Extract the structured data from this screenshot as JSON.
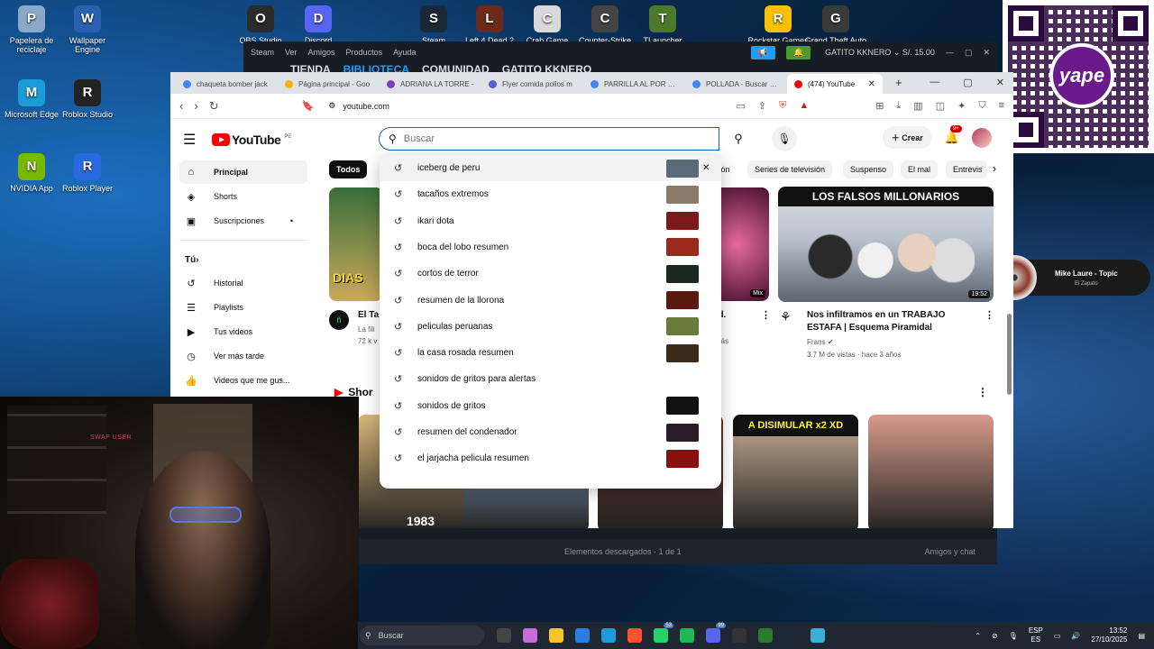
{
  "desktop": {
    "icons": [
      {
        "label": "Papelera de reciclaje",
        "icon": "recycle-bin-icon",
        "color": "#8aa9c9"
      },
      {
        "label": "Wallpaper Engine",
        "icon": "wallpaper-engine-icon",
        "color": "#2b5fb0"
      },
      {
        "label": "Microsoft Edge",
        "icon": "edge-icon",
        "color": "#1d9bd8"
      },
      {
        "label": "Roblox Studio",
        "icon": "roblox-studio-icon",
        "color": "#222222"
      },
      {
        "label": "NVIDIA App",
        "icon": "nvidia-icon",
        "color": "#76b900"
      },
      {
        "label": "Roblox Player",
        "icon": "roblox-player-icon",
        "color": "#2a6ae0"
      },
      {
        "label": "OBS Studio",
        "icon": "obs-icon",
        "color": "#2b2b2b"
      },
      {
        "label": "Discord",
        "icon": "discord-icon",
        "color": "#5865f2"
      },
      {
        "label": "Steam",
        "icon": "steam-icon",
        "color": "#1b2838"
      },
      {
        "label": "Left 4 Dead 2",
        "icon": "l4d2-icon",
        "color": "#6b2a1a"
      },
      {
        "label": "Crab Game",
        "icon": "crab-game-icon",
        "color": "#d9d9d9"
      },
      {
        "label": "Counter-Strike",
        "icon": "counter-strike-icon",
        "color": "#444444"
      },
      {
        "label": "TLauncher",
        "icon": "tlauncher-icon",
        "color": "#4d7a2a"
      },
      {
        "label": "Rockstar Games",
        "icon": "rockstar-icon",
        "color": "#f7c100"
      },
      {
        "label": "Grand Theft Auto",
        "icon": "gta-icon",
        "color": "#3a3a3a"
      }
    ]
  },
  "steam": {
    "menu": [
      "Steam",
      "Ver",
      "Amigos",
      "Productos",
      "Ayuda"
    ],
    "user": "GATITO KKNERO",
    "balance": "S/. 15.00",
    "nav": [
      "TIENDA",
      "BIBLIOTECA",
      "COMUNIDAD",
      "GATITO KKNERO"
    ],
    "footer_left": "Elementos descargados - 1 de 1",
    "footer_right": "Amigos y chat"
  },
  "music": {
    "title": "Mike Laure - Topic",
    "subtitle": "El Zapato"
  },
  "qr": {
    "brand": "yape"
  },
  "browser": {
    "tabs": [
      {
        "title": "chaqueta bomber jack",
        "color": "#4285f4"
      },
      {
        "title": "Página principal - Goo",
        "color": "#f4b400"
      },
      {
        "title": "ADRIANA LA TORRE -",
        "color": "#7b3fbf"
      },
      {
        "title": "Flyer comida pollos m",
        "color": "#5b5bd6"
      },
      {
        "title": "PARRILLA AL POR MA",
        "color": "#4285f4"
      },
      {
        "title": "POLLADA - Buscar con",
        "color": "#4285f4"
      },
      {
        "title": "(474) YouTube",
        "color": "#ff0000"
      }
    ],
    "url": "youtube.com"
  },
  "youtube": {
    "logo": "YouTube",
    "region": "PE",
    "search_placeholder": "Buscar",
    "crear": "Crear",
    "notifications": "9+",
    "sidebar": {
      "main": [
        {
          "label": "Principal",
          "icon": "home-icon"
        },
        {
          "label": "Shorts",
          "icon": "shorts-icon"
        },
        {
          "label": "Suscripciones",
          "icon": "subscriptions-icon"
        }
      ],
      "you_header": "Tú",
      "you": [
        {
          "label": "Historial",
          "icon": "history-icon"
        },
        {
          "label": "Playlists",
          "icon": "playlists-icon"
        },
        {
          "label": "Tus videos",
          "icon": "your-videos-icon"
        },
        {
          "label": "Ver más tarde",
          "icon": "watch-later-icon"
        },
        {
          "label": "Videos que me gus...",
          "icon": "liked-videos-icon"
        }
      ]
    },
    "chips": [
      "Todos",
      "tón",
      "Series de televisión",
      "Suspenso",
      "El mal",
      "Entrevis"
    ],
    "videos": [
      {
        "title": "El Ta",
        "channel": "La fili",
        "meta": "72 k v",
        "thumb_text": "DIAS"
      },
      {
        "title": "(prod.",
        "channel": "",
        "meta": "más",
        "badge": "Mix"
      },
      {
        "title": "Nos infiltramos en un TRABAJO ESTAFA | Esquema Piramidal",
        "channel": "Frans",
        "meta": "3.7 M de vistas · hace 3 años",
        "duration": "19:52",
        "thumb_text": "LOS FALSOS MILLONARIOS"
      }
    ],
    "shorts_label": "Shor",
    "shorts": [
      {
        "overlay": "1983",
        "color": "#d9b77a"
      },
      {
        "overlay": "",
        "color": "#9fc6ef"
      },
      {
        "overlay": "",
        "color": "#6e3a2e"
      },
      {
        "overlay": "A DISIMULAR x2 XD",
        "color": "#c9b094"
      },
      {
        "overlay": "",
        "color": "#d89a8a"
      }
    ],
    "suggestions": [
      {
        "text": "iceberg de peru",
        "thumb": "#5a6a7a",
        "remove": true
      },
      {
        "text": "tacaños extremos",
        "thumb": "#8a7a6a"
      },
      {
        "text": "ikari dota",
        "thumb": "#7a1a1a"
      },
      {
        "text": "boca del lobo resumen",
        "thumb": "#9a2a1a"
      },
      {
        "text": "cortos de terror",
        "thumb": "#1a2a1a"
      },
      {
        "text": "resumen de la llorona",
        "thumb": "#5a1a10"
      },
      {
        "text": "peliculas peruanas",
        "thumb": "#6a7a3a"
      },
      {
        "text": "la casa rosada resumen",
        "thumb": "#3a2a1a"
      },
      {
        "text": "sonidos de gritos para alertas",
        "thumb": ""
      },
      {
        "text": "sonidos de gritos",
        "thumb": "#111111"
      },
      {
        "text": "resumen del condenador",
        "thumb": "#2a1a2a"
      },
      {
        "text": "el jarjacha pelicula resumen",
        "thumb": "#8a1010"
      }
    ]
  },
  "webcam": {
    "tag": "SWAP USER"
  },
  "taskbar": {
    "search": "Buscar",
    "apps": [
      {
        "icon": "task-view-icon",
        "color": "#444"
      },
      {
        "icon": "copilot-icon",
        "color": "#c86dd7"
      },
      {
        "icon": "explorer-icon",
        "color": "#f4c430"
      },
      {
        "icon": "store-icon",
        "color": "#2d7de0"
      },
      {
        "icon": "edge-icon",
        "color": "#1d9bd8"
      },
      {
        "icon": "brave-icon",
        "color": "#fb542b"
      },
      {
        "icon": "whatsapp-icon",
        "color": "#25d366",
        "count": "53"
      },
      {
        "icon": "spotify-icon",
        "color": "#1db954"
      },
      {
        "icon": "discord-icon",
        "color": "#5865f2",
        "count": "99"
      },
      {
        "icon": "obs-icon",
        "color": "#333"
      },
      {
        "icon": "xbox-icon",
        "color": "#2b7a2b"
      },
      {
        "icon": "steam-icon",
        "color": "#1b2838"
      },
      {
        "icon": "notepad-icon",
        "color": "#3ab0d6"
      }
    ],
    "lang": "ESP",
    "lang2": "ES",
    "time": "13:52",
    "date": "27/10/2025"
  }
}
